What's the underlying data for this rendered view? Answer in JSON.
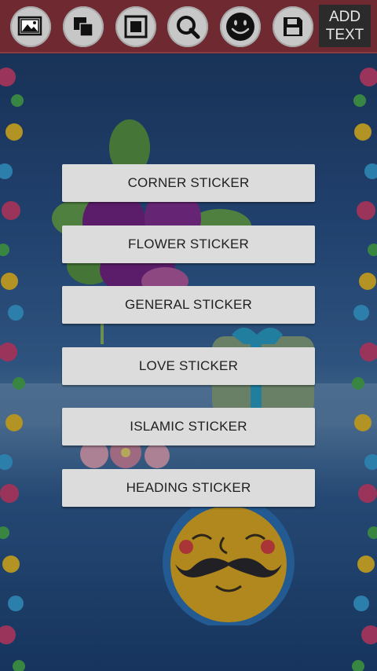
{
  "toolbar": {
    "tools": [
      {
        "name": "gallery-icon"
      },
      {
        "name": "layers-icon"
      },
      {
        "name": "frame-icon"
      },
      {
        "name": "search-zoom-icon"
      },
      {
        "name": "smiley-icon"
      },
      {
        "name": "save-icon"
      }
    ],
    "add_text_line1": "ADD",
    "add_text_line2": "TEXT"
  },
  "menu": {
    "items": [
      {
        "label": "CORNER STICKER"
      },
      {
        "label": "FLOWER STICKER"
      },
      {
        "label": "GENERAL STICKER"
      },
      {
        "label": "LOVE STICKER"
      },
      {
        "label": "ISLAMIC STICKER"
      },
      {
        "label": "HEADING STICKER"
      }
    ]
  },
  "colors": {
    "toolbar_bg": "#6e2a30",
    "button_bg": "#dcdcdc",
    "canvas_bg": "#2a5185"
  }
}
